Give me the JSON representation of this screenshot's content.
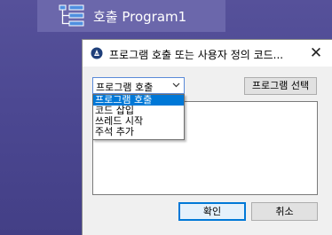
{
  "node": {
    "label": "호출 Program1",
    "icon": "call-program-icon"
  },
  "dialog": {
    "title": "프로그램 호출 또는 사용자 정의 코드...",
    "app_icon": "app-logo-icon",
    "close_label": "✕",
    "combo": {
      "selected": "프로그램 호출",
      "options": [
        "프로그램 호출",
        "코드 삽입",
        "쓰레드 시작",
        "주석 추가"
      ]
    },
    "select_program_label": "프로그램 선택",
    "code_text": "",
    "ok_label": "확인",
    "cancel_label": "취소"
  },
  "colors": {
    "background": "#4c4892",
    "node_tile": "#6b67ab",
    "highlight": "#0078d7"
  }
}
